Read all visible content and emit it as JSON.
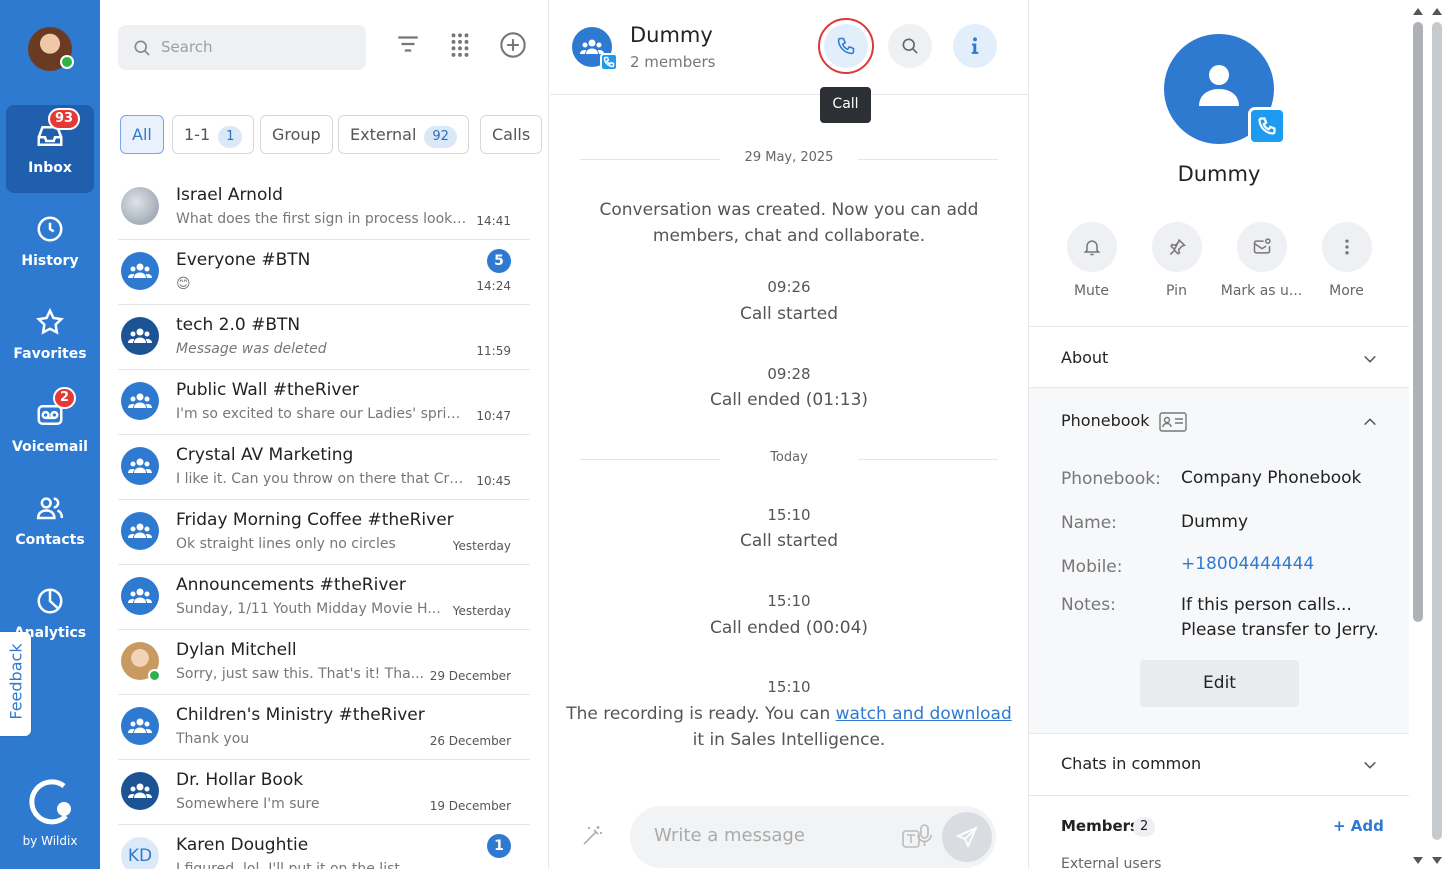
{
  "nav": {
    "items": [
      {
        "label": "Inbox",
        "icon": "inbox-icon",
        "badge": "93",
        "active": true
      },
      {
        "label": "History",
        "icon": "clock-icon"
      },
      {
        "label": "Favorites",
        "icon": "star-icon"
      },
      {
        "label": "Voicemail",
        "icon": "voicemail-icon",
        "badge": "2"
      },
      {
        "label": "Contacts",
        "icon": "contacts-icon"
      },
      {
        "label": "Analytics",
        "icon": "analytics-icon"
      }
    ],
    "feedback": "Feedback",
    "by": "by Wildix"
  },
  "list": {
    "search_placeholder": "Search",
    "filters": [
      {
        "label": "All",
        "active": true
      },
      {
        "label": "1-1",
        "count": "1"
      },
      {
        "label": "Group"
      },
      {
        "label": "External",
        "count": "92"
      },
      {
        "label": "Calls"
      }
    ],
    "conversations": [
      {
        "name": "Israel Arnold",
        "preview": "What does the first sign in process look ...",
        "time": "14:41",
        "avatar": "photo"
      },
      {
        "name": "Everyone #BTN",
        "preview": "😊",
        "time": "14:24",
        "badge": "5",
        "avatar": "group"
      },
      {
        "name": "tech 2.0 #BTN",
        "preview": "Message was deleted",
        "time": "11:59",
        "avatar": "group-dark",
        "italic": true
      },
      {
        "name": "Public Wall #theRiver",
        "preview": "I'm so excited to share our Ladies' sprin...",
        "time": "10:47",
        "avatar": "group"
      },
      {
        "name": "Crystal AV Marketing",
        "preview": "I like it. Can you throw on there that Cry...",
        "time": "10:45",
        "avatar": "group"
      },
      {
        "name": "Friday Morning Coffee #theRiver",
        "preview": "Ok straight lines only no circles",
        "time": "Yesterday",
        "avatar": "group"
      },
      {
        "name": "Announcements #theRiver",
        "preview": "Sunday, 1/11 Youth Midday Movie H...",
        "time": "Yesterday",
        "avatar": "group"
      },
      {
        "name": "Dylan Mitchell",
        "preview": "Sorry, just saw this. That's it! Tha...",
        "time": "29 December",
        "avatar": "photo-child"
      },
      {
        "name": "Children's Ministry #theRiver",
        "preview": "Thank you",
        "time": "26 December",
        "avatar": "group"
      },
      {
        "name": "Dr. Hollar Book",
        "preview": "Somewhere I'm sure",
        "time": "19 December",
        "avatar": "group-dark"
      },
      {
        "name": "Karen Doughtie",
        "preview": "I figured, lol. I'll put it on the list.",
        "time": "",
        "badge": "1",
        "avatar": "initials",
        "initials": "KD"
      }
    ]
  },
  "chat": {
    "title": "Dummy",
    "subtitle": "2 members",
    "tooltip": "Call",
    "date1": "29 May, 2025",
    "created": "Conversation was created. Now you can add members, chat and collaborate.",
    "events": [
      {
        "time": "09:26",
        "text": "Call started"
      },
      {
        "time": "09:28",
        "text": "Call ended (01:13)"
      }
    ],
    "date2": "Today",
    "events2": [
      {
        "time": "15:10",
        "text": "Call started"
      },
      {
        "time": "15:10",
        "text": "Call ended (00:04)"
      }
    ],
    "recording_time": "15:10",
    "recording_pre": "The recording is ready. You can ",
    "recording_link": "watch and download",
    "recording_post": "it in Sales Intelligence.",
    "composer_placeholder": "Write a message"
  },
  "details": {
    "name": "Dummy",
    "actions": [
      {
        "label": "Mute",
        "icon": "bell-icon"
      },
      {
        "label": "Pin",
        "icon": "pin-icon"
      },
      {
        "label": "Mark as u...",
        "icon": "mark-unread-icon"
      },
      {
        "label": "More",
        "icon": "more-icon"
      }
    ],
    "about": "About",
    "phonebook_title": "Phonebook",
    "rows": {
      "phonebook_label": "Phonebook:",
      "phonebook_value": "Company Phonebook",
      "name_label": "Name:",
      "name_value": "Dummy",
      "mobile_label": "Mobile:",
      "mobile_value": "+18004444444",
      "notes_label": "Notes:",
      "notes_value1": "If this person calls...",
      "notes_value2": "Please transfer to Jerry."
    },
    "edit": "Edit",
    "chats_in_common": "Chats in common",
    "members": "Members",
    "members_count": "2",
    "add": "+ Add",
    "external_users": "External users"
  },
  "colors": {
    "brand": "#2f7ad1",
    "badge": "#e53935",
    "online": "#2db34a",
    "highlight": "#d93a3a"
  }
}
